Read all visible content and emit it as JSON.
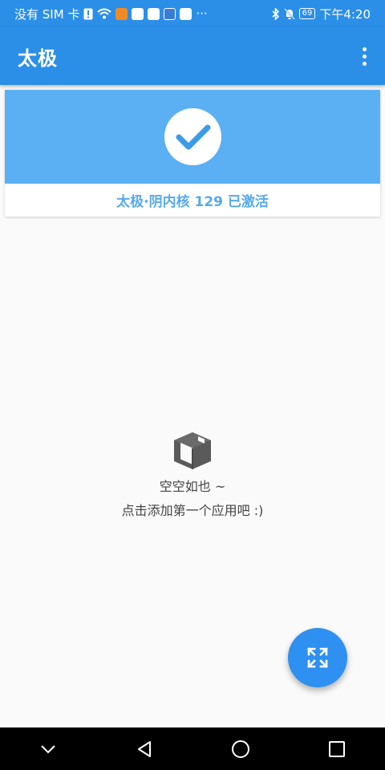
{
  "status_bar": {
    "carrier": "没有 SIM 卡",
    "more": "···",
    "battery": "69",
    "time": "下午4:20"
  },
  "app_bar": {
    "title": "太极"
  },
  "status_card": {
    "text": "太极·阴内核 129 已激活"
  },
  "empty_state": {
    "line1": "空空如也 ~",
    "line2": "点击添加第一个应用吧 :)"
  },
  "icons": {
    "menu": "more-vert-icon",
    "check": "check-icon",
    "box": "box-icon",
    "fab": "expand-icon",
    "nav": [
      "back-chevron-icon",
      "back-triangle-icon",
      "home-circle-icon",
      "recents-square-icon"
    ]
  },
  "colors": {
    "primary": "#2b8fe8",
    "card_top": "#5bb0f3",
    "status_text": "#57a9ea",
    "fab": "#2e90f0"
  }
}
